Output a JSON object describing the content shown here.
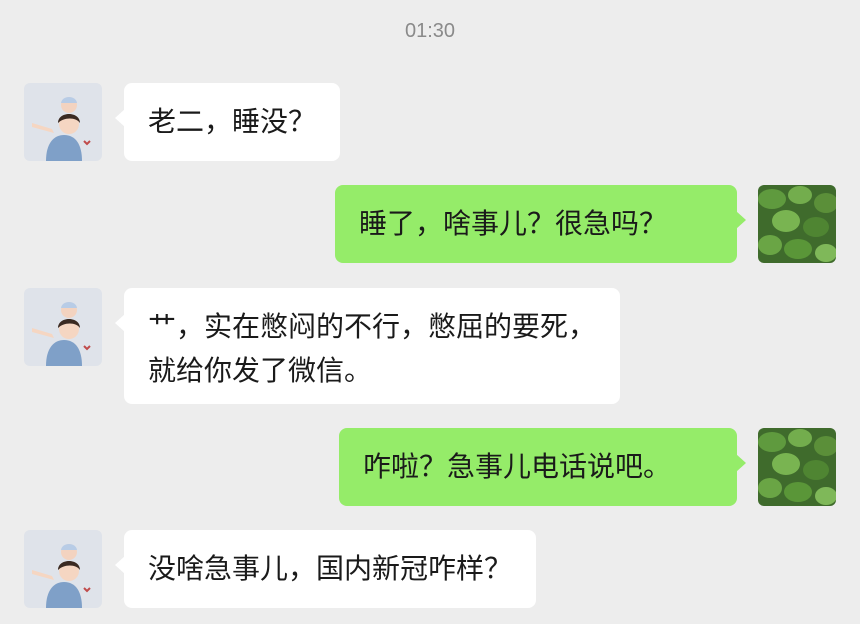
{
  "chat": {
    "timestamp": "01:30",
    "messages": [
      {
        "side": "received",
        "avatar": "cartoon-parent-child-avatar",
        "lines": [
          "老二，睡没？"
        ]
      },
      {
        "side": "sent",
        "avatar": "green-leaves-avatar",
        "lines": [
          "睡了，啥事儿？很急吗？"
        ]
      },
      {
        "side": "received",
        "avatar": "cartoon-parent-child-avatar",
        "lines": [
          "艹，实在憋闷的不行，憋屈的要死，",
          "就给你发了微信。"
        ]
      },
      {
        "side": "sent",
        "avatar": "green-leaves-avatar",
        "lines": [
          "咋啦？急事儿电话说吧。"
        ]
      },
      {
        "side": "received",
        "avatar": "cartoon-parent-child-avatar",
        "lines": [
          "没啥急事儿，国内新冠咋样？"
        ]
      }
    ]
  },
  "colors": {
    "background": "#ededed",
    "incoming_bubble": "#ffffff",
    "outgoing_bubble": "#95ec69",
    "timestamp_text": "#8a8a8a"
  }
}
